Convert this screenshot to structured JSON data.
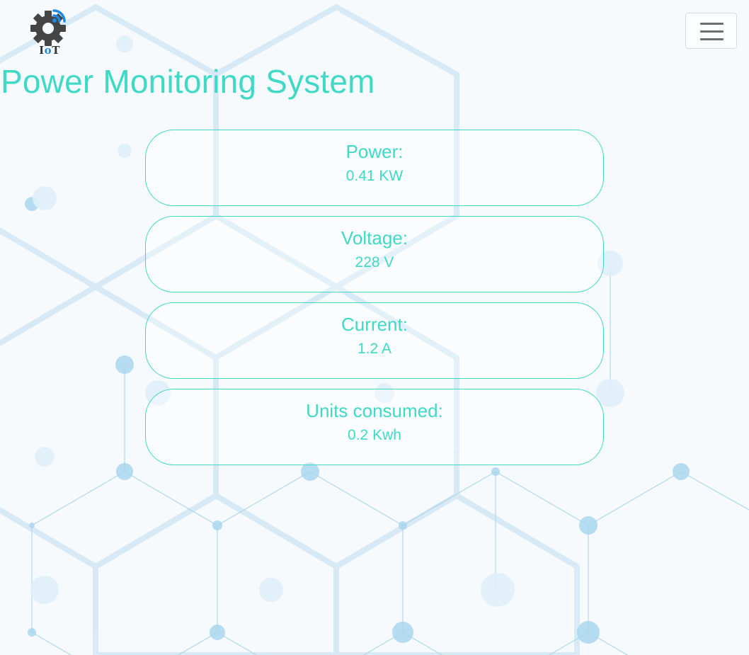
{
  "app": {
    "logo_text_i": "I",
    "logo_text_o": "o",
    "logo_text_t": "T",
    "title": "Power Monitoring System"
  },
  "navbar": {
    "menu_icon": "hamburger-icon",
    "logo_icon": "gear-wifi-icon"
  },
  "readings": [
    {
      "label": "Power:",
      "value": "0.41 KW"
    },
    {
      "label": "Voltage:",
      "value": "228 V"
    },
    {
      "label": "Current:",
      "value": "1.2 A"
    },
    {
      "label": "Units consumed:",
      "value": "0.2 Kwh"
    }
  ],
  "colors": {
    "accent": "#3fd9c6",
    "background": "#f7fafd",
    "hex_pattern": "#b8dcee",
    "logo_gear": "#444444",
    "logo_signal": "#1e88e5"
  }
}
